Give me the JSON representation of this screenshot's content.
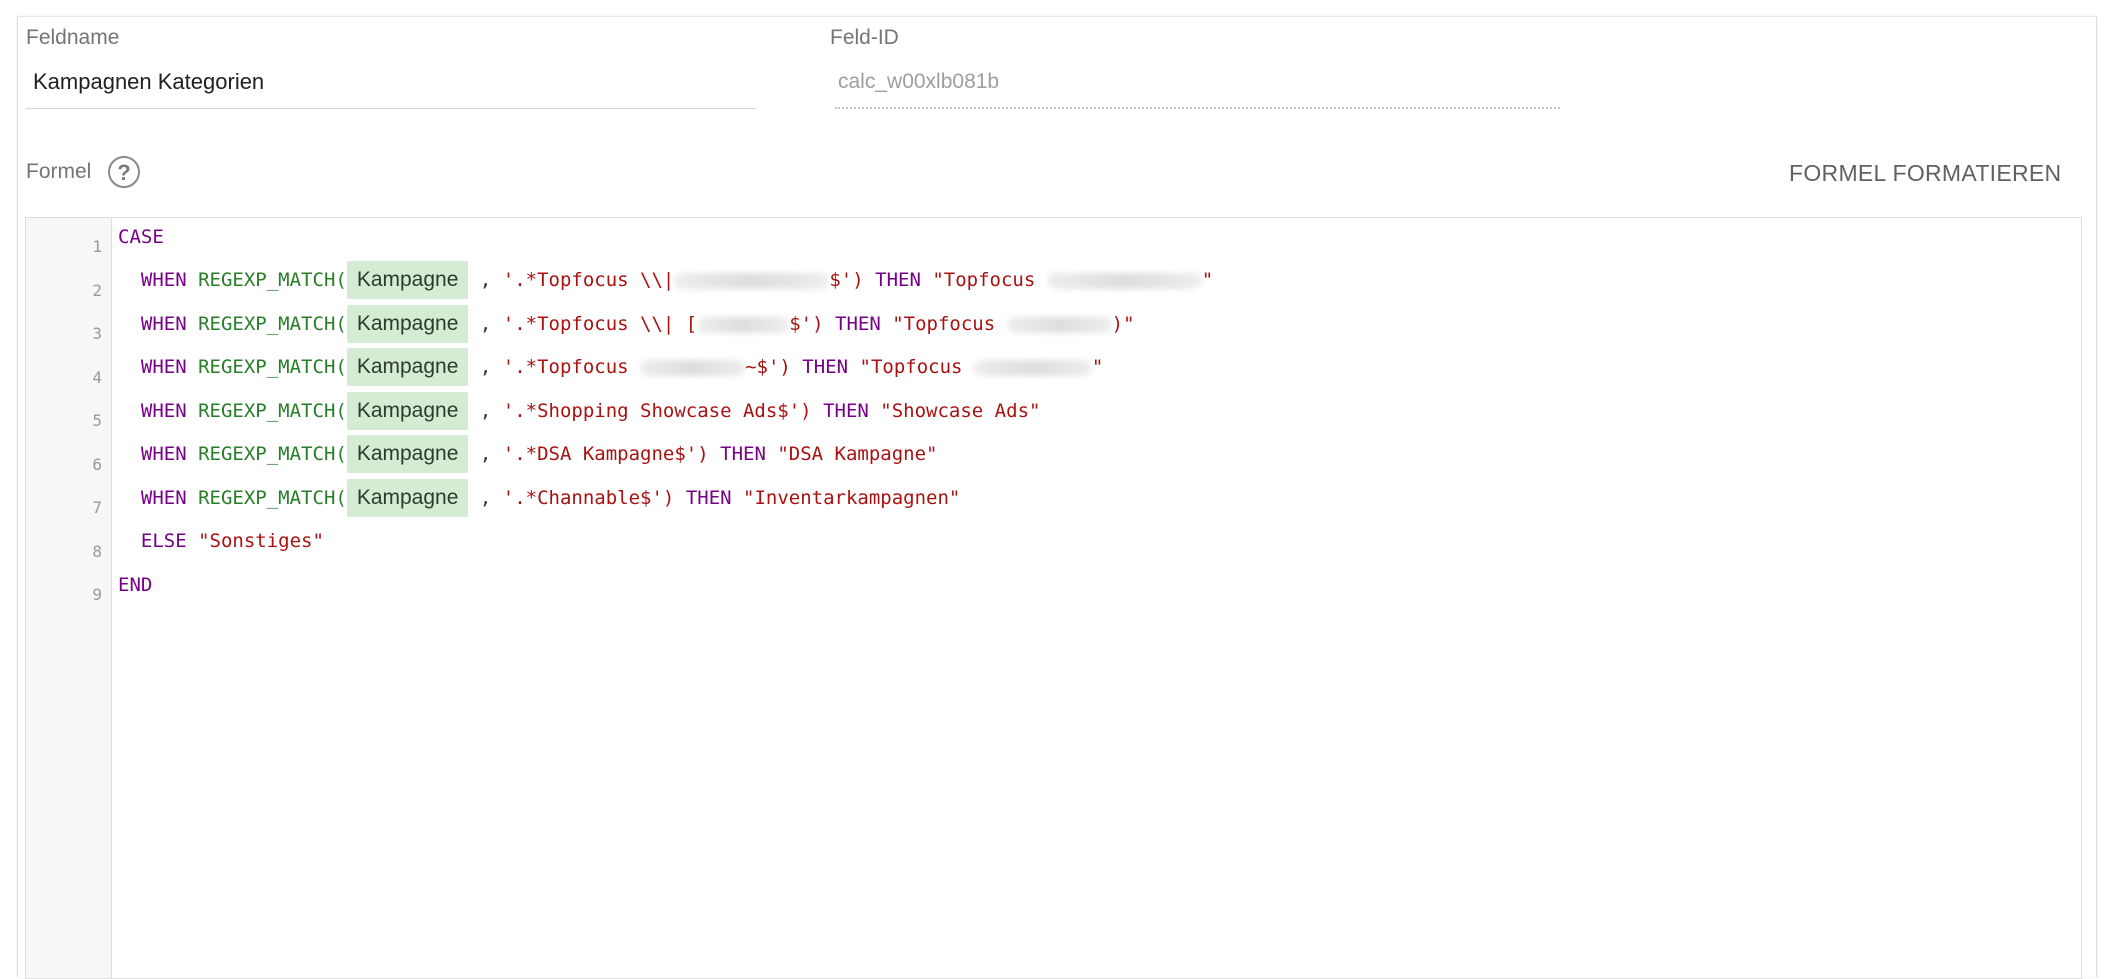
{
  "form": {
    "field_name_label": "Feldname",
    "field_name_value": "Kampagnen Kategorien",
    "field_id_label": "Feld-ID",
    "field_id_value": "calc_w00xlb081b",
    "formula_label": "Formel",
    "help_icon_glyph": "?",
    "format_button": "FORMEL FORMATIEREN"
  },
  "editor": {
    "line_numbers": [
      "1",
      "2",
      "3",
      "4",
      "5",
      "6",
      "7",
      "8",
      "9"
    ],
    "tokens": {
      "case": "CASE",
      "when": "WHEN",
      "func": "REGEXP_MATCH(",
      "field": "Kampagne",
      "comma": ",",
      "then": "THEN",
      "else": "ELSE",
      "end": "END"
    },
    "lines": [
      {
        "pattern_a": "'.*Topfocus \\\\|",
        "pattern_b": "$')",
        "result_a": "\"Topfocus",
        "result_b": "\""
      },
      {
        "pattern_a": "'.*Topfocus \\\\| [",
        "pattern_b": "$')",
        "result_a": "\"Topfocus",
        "result_b": ")\""
      },
      {
        "pattern_a": "'.*Topfocus",
        "pattern_b": "~$')",
        "result_a": "\"Topfocus",
        "result_b": "\""
      },
      {
        "pattern_a": "'.*Shopping Showcase Ads$')",
        "result_a": "\"Showcase Ads\""
      },
      {
        "pattern_a": "'.*DSA Kampagne$')",
        "result_a": "\"DSA Kampagne\""
      },
      {
        "pattern_a": "'.*Channable$')",
        "result_a": "\"Inventarkampagnen\""
      }
    ],
    "else_value": "\"Sonstiges\""
  },
  "colors": {
    "keyword": "#770088",
    "function": "#267f26",
    "string": "#aa1111",
    "field_chip_bg": "#d4ecd4"
  },
  "icons": {
    "help": "question-circle-icon"
  }
}
